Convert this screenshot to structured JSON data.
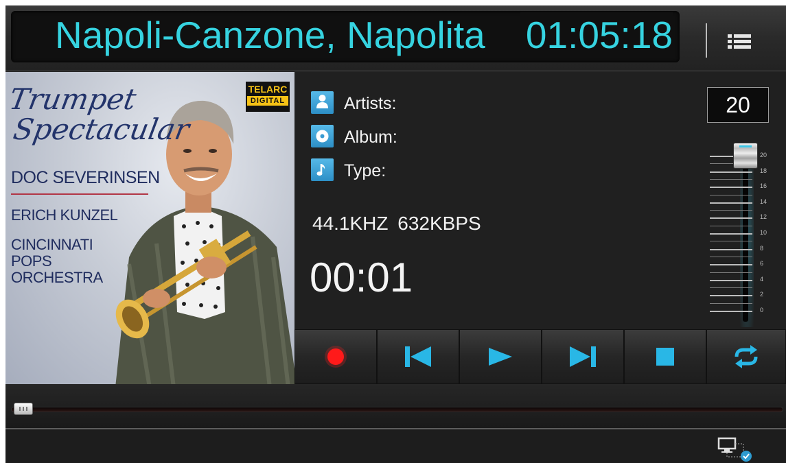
{
  "header": {
    "track_title": "Napoli-Canzone, Napolita",
    "total_time": "01:05:18",
    "menu_icon": "list-menu-icon"
  },
  "album_art": {
    "script_line1": "Trumpet",
    "script_line2": "Spectacular",
    "artist_name": "DOC SEVERINSEN",
    "conductor": "ERICH KUNZEL",
    "ensemble_line1": "CINCINNATI",
    "ensemble_line2": "POPS",
    "ensemble_line3": "ORCHESTRA",
    "label_top": "TELARC",
    "label_mid": "DIGITAL"
  },
  "info": {
    "artists_label": "Artists:",
    "album_label": "Album:",
    "type_label": "Type:",
    "bitrate": "44.1KHZ  632KBPS",
    "elapsed": "00:01"
  },
  "volume": {
    "value": "20",
    "level_fraction": 1.0,
    "scale": [
      "20",
      "18",
      "16",
      "14",
      "12",
      "10",
      "8",
      "6",
      "4",
      "2",
      "0"
    ]
  },
  "controls": {
    "icons": [
      "record-icon",
      "previous-track-icon",
      "play-icon",
      "next-track-icon",
      "stop-icon",
      "repeat-icon"
    ]
  },
  "progress": {
    "position_fraction": 0.0
  },
  "status": {
    "device_icon": "display-connected-icon"
  },
  "colors": {
    "accent_cyan": "#36d3e0",
    "icon_blue": "#2d9bd0",
    "record_red": "#ff1a1a"
  }
}
